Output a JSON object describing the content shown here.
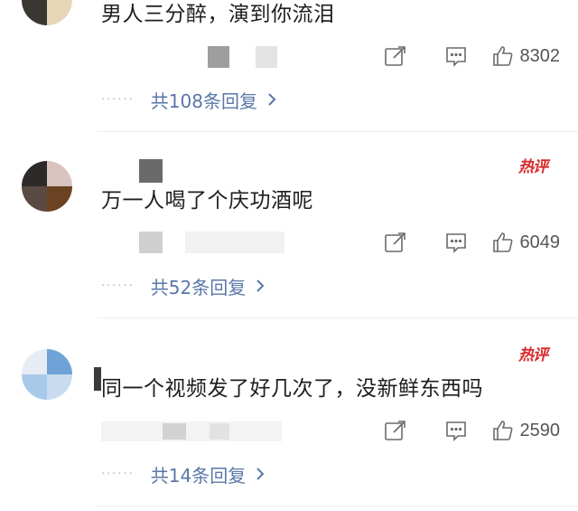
{
  "comments": [
    {
      "text": "男人三分醉，演到你流泪",
      "meta": "",
      "hot_label": "",
      "like_count": "8302",
      "replies_label": "共108条回复",
      "avatar_colors": [
        "#2b2a28",
        "#f1e3cb",
        "#3a3733",
        "#e8d6b8"
      ]
    },
    {
      "text": "万一人喝了个庆功酒呢",
      "meta": "",
      "hot_label": "热评",
      "like_count": "6049",
      "replies_label": "共52条回复",
      "avatar_colors": [
        "#2e2a2a",
        "#d9c3c0",
        "#5a4a43",
        "#6b4322"
      ]
    },
    {
      "text": "同一个视频发了好几次了，没新鲜东西吗",
      "meta": "",
      "hot_label": "热评",
      "like_count": "2590",
      "replies_label": "共14条回复",
      "avatar_colors": [
        "#e6ecf3",
        "#6fa3d8",
        "#a7c9ea",
        "#c9dcef"
      ]
    }
  ],
  "icons": {
    "share": "share-icon",
    "comment": "comment-icon",
    "like": "thumbs-up-icon",
    "chevron": "chevron-right-icon"
  },
  "colors": {
    "hot": "#d9292b",
    "link": "#5a77a8",
    "muted": "#9a9a9a"
  }
}
